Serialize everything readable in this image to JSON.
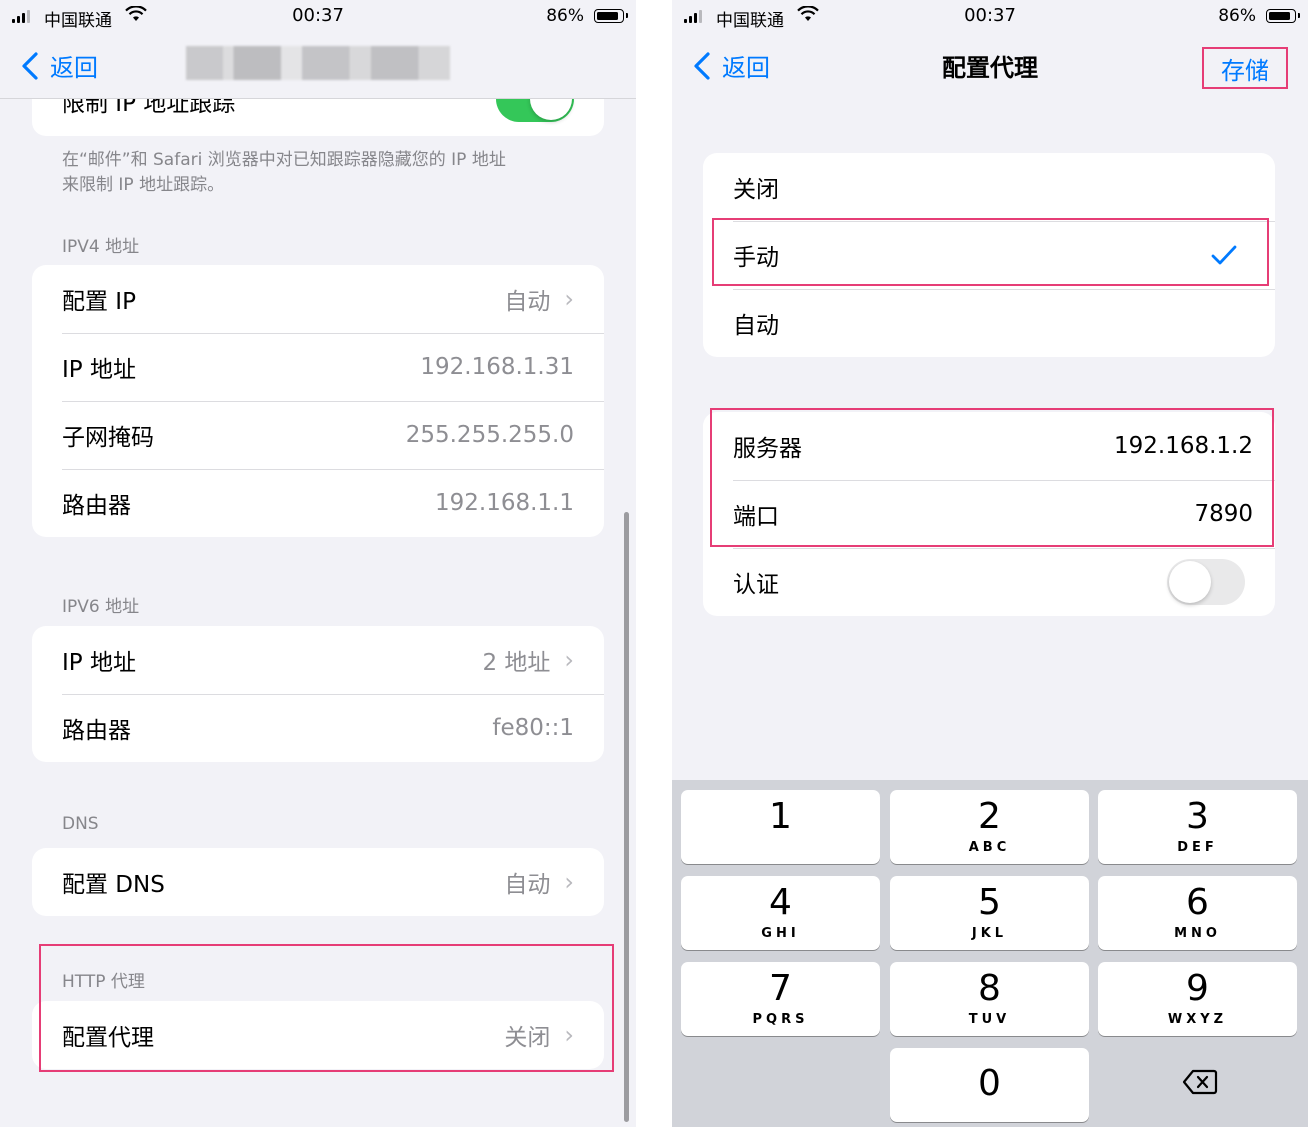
{
  "colors": {
    "accent": "#007aff",
    "highlight": "#e63d76",
    "toggle_on": "#34c759"
  },
  "status_bar": {
    "carrier": "中国联通",
    "time": "00:37",
    "battery": "86%",
    "battery_level": 0.86
  },
  "left": {
    "back_label": "返回",
    "partial_row_label": "限制 IP 地址跟踪",
    "limit_ip_toggle": "on",
    "limit_note_line1": "在“邮件”和 Safari 浏览器中对已知跟踪器隐藏您的 IP 地址",
    "limit_note_line2": "来限制 IP 地址跟踪。",
    "ipv4": {
      "header": "IPV4 地址",
      "rows": [
        {
          "label": "配置 IP",
          "value": "自动"
        },
        {
          "label": "IP 地址",
          "value": "192.168.1.31"
        },
        {
          "label": "子网掩码",
          "value": "255.255.255.0"
        },
        {
          "label": "路由器",
          "value": "192.168.1.1"
        }
      ]
    },
    "ipv6": {
      "header": "IPV6 地址",
      "rows": [
        {
          "label": "IP 地址",
          "value": "2 地址"
        },
        {
          "label": "路由器",
          "value": "fe80::1"
        }
      ]
    },
    "dns": {
      "header": "DNS",
      "row_label": "配置 DNS",
      "row_value": "自动"
    },
    "http_proxy": {
      "header": "HTTP 代理",
      "row_label": "配置代理",
      "row_value": "关闭"
    }
  },
  "right": {
    "back_label": "返回",
    "title": "配置代理",
    "save_label": "存储",
    "options": [
      {
        "label": "关闭"
      },
      {
        "label": "手动",
        "selected": true
      },
      {
        "label": "自动"
      }
    ],
    "server": {
      "label": "服务器",
      "value": "192.168.1.2"
    },
    "port": {
      "label": "端口",
      "value": "7890"
    },
    "auth": {
      "label": "认证",
      "toggle": "off"
    }
  },
  "keyboard": {
    "keys": [
      {
        "num": "1",
        "letters": ""
      },
      {
        "num": "2",
        "letters": "ABC"
      },
      {
        "num": "3",
        "letters": "DEF"
      },
      {
        "num": "4",
        "letters": "GHI"
      },
      {
        "num": "5",
        "letters": "JKL"
      },
      {
        "num": "6",
        "letters": "MNO"
      },
      {
        "num": "7",
        "letters": "PQRS"
      },
      {
        "num": "8",
        "letters": "TUV"
      },
      {
        "num": "9",
        "letters": "WXYZ"
      },
      {
        "num": "0",
        "letters": ""
      }
    ],
    "delete_icon": "delete-backspace-icon"
  }
}
